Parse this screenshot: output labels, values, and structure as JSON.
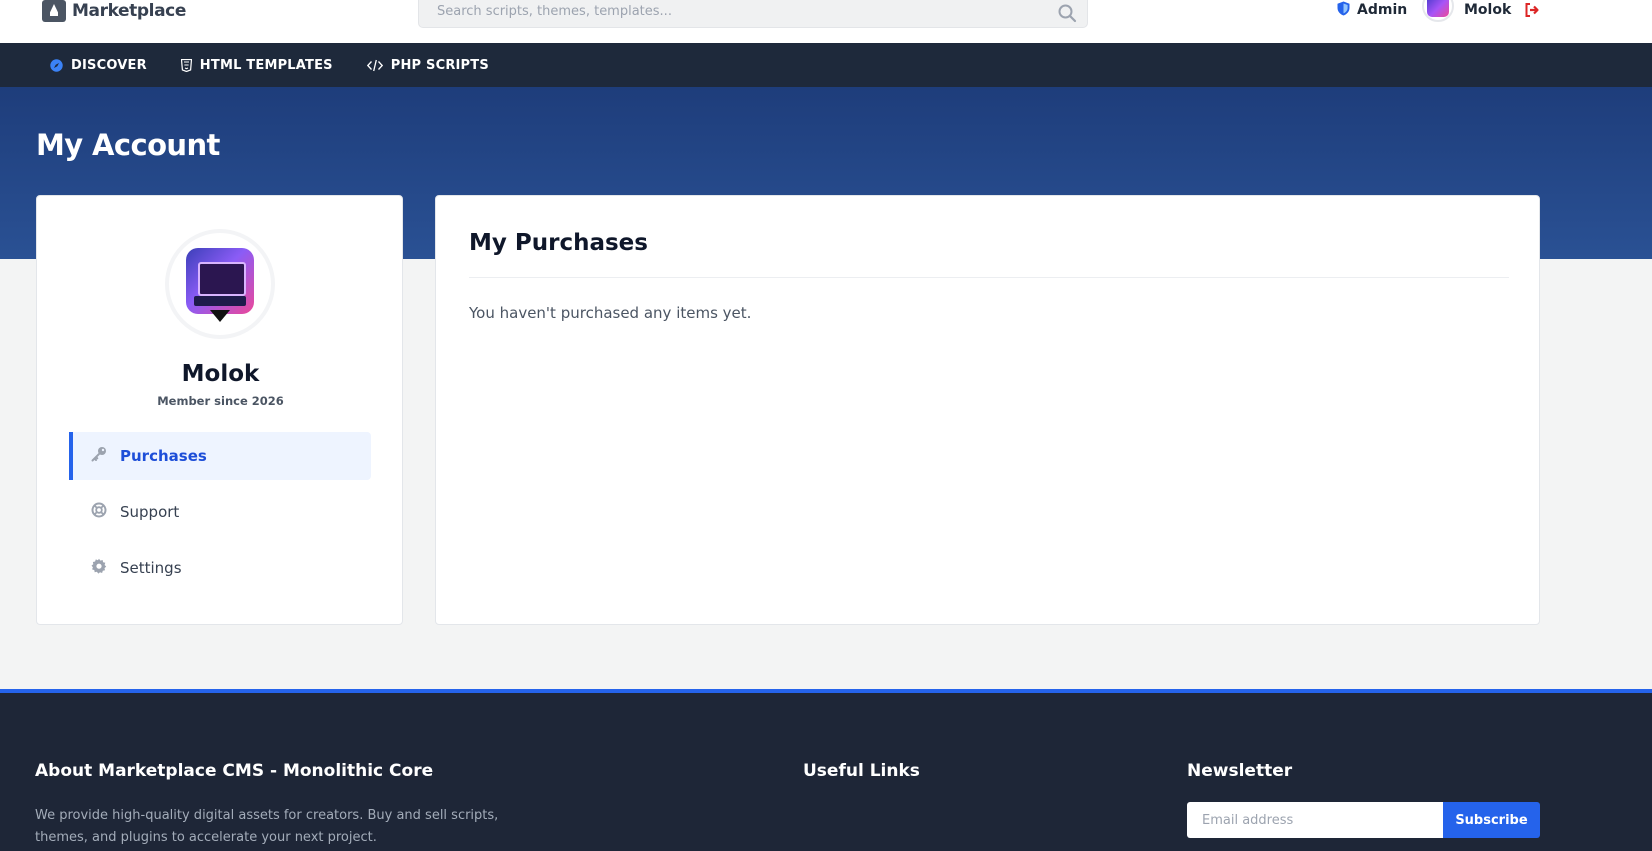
{
  "header": {
    "logo_text": "Marketplace",
    "search_placeholder": "Search scripts, themes, templates...",
    "search_value": "",
    "admin_label": "Admin",
    "user_name": "Molok",
    "icons": {
      "logo": "rocket-logo-icon",
      "search": "search-icon",
      "admin": "shield-icon",
      "logout": "logout-icon"
    },
    "admin_color": "#2563eb",
    "logout_color": "#dc2626"
  },
  "nav": {
    "items": [
      {
        "label": "DISCOVER",
        "icon": "compass-icon"
      },
      {
        "label": "HTML TEMPLATES",
        "icon": "html5-icon"
      },
      {
        "label": "PHP SCRIPTS",
        "icon": "code-icon"
      }
    ]
  },
  "hero": {
    "title": "My Account"
  },
  "profile": {
    "name": "Molok",
    "member_since": "Member since 2026",
    "menu": [
      {
        "label": "Purchases",
        "icon": "key-icon",
        "active": true
      },
      {
        "label": "Support",
        "icon": "life-ring-icon",
        "active": false
      },
      {
        "label": "Settings",
        "icon": "gear-icon",
        "active": false
      }
    ]
  },
  "purchases": {
    "title": "My Purchases",
    "empty_message": "You haven't purchased any items yet."
  },
  "footer": {
    "about_title": "About Marketplace CMS - Monolithic Core",
    "about_text": "We provide high-quality digital assets for creators. Buy and sell scripts, themes, and plugins to accelerate your next project.",
    "links_title": "Useful Links",
    "newsletter_title": "Newsletter",
    "email_placeholder": "Email address",
    "subscribe_label": "Subscribe"
  },
  "colors": {
    "accent": "#2563eb",
    "nav_bg": "#1e293b",
    "hero_bg": "#27498b",
    "footer_bg": "#1e2637"
  }
}
